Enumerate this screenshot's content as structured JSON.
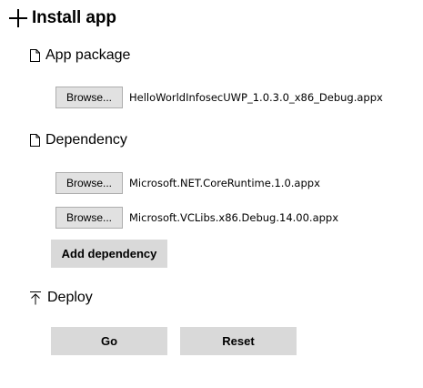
{
  "header": {
    "title": "Install app",
    "icon": "plus-icon"
  },
  "app_package": {
    "heading": "App package",
    "icon": "document-icon",
    "browse_label": "Browse...",
    "file_name": "HelloWorldInfosecUWP_1.0.3.0_x86_Debug.appx"
  },
  "dependency": {
    "heading": "Dependency",
    "icon": "document-icon",
    "items": [
      {
        "browse_label": "Browse...",
        "file_name": "Microsoft.NET.CoreRuntime.1.0.appx"
      },
      {
        "browse_label": "Browse...",
        "file_name": "Microsoft.VCLibs.x86.Debug.14.00.appx"
      }
    ],
    "add_label": "Add dependency"
  },
  "deploy": {
    "heading": "Deploy",
    "icon": "upload-icon",
    "go_label": "Go",
    "reset_label": "Reset"
  },
  "colors": {
    "button_bg": "#e1e1e1",
    "button_border": "#adadad",
    "action_bg": "#d9d9d9"
  }
}
